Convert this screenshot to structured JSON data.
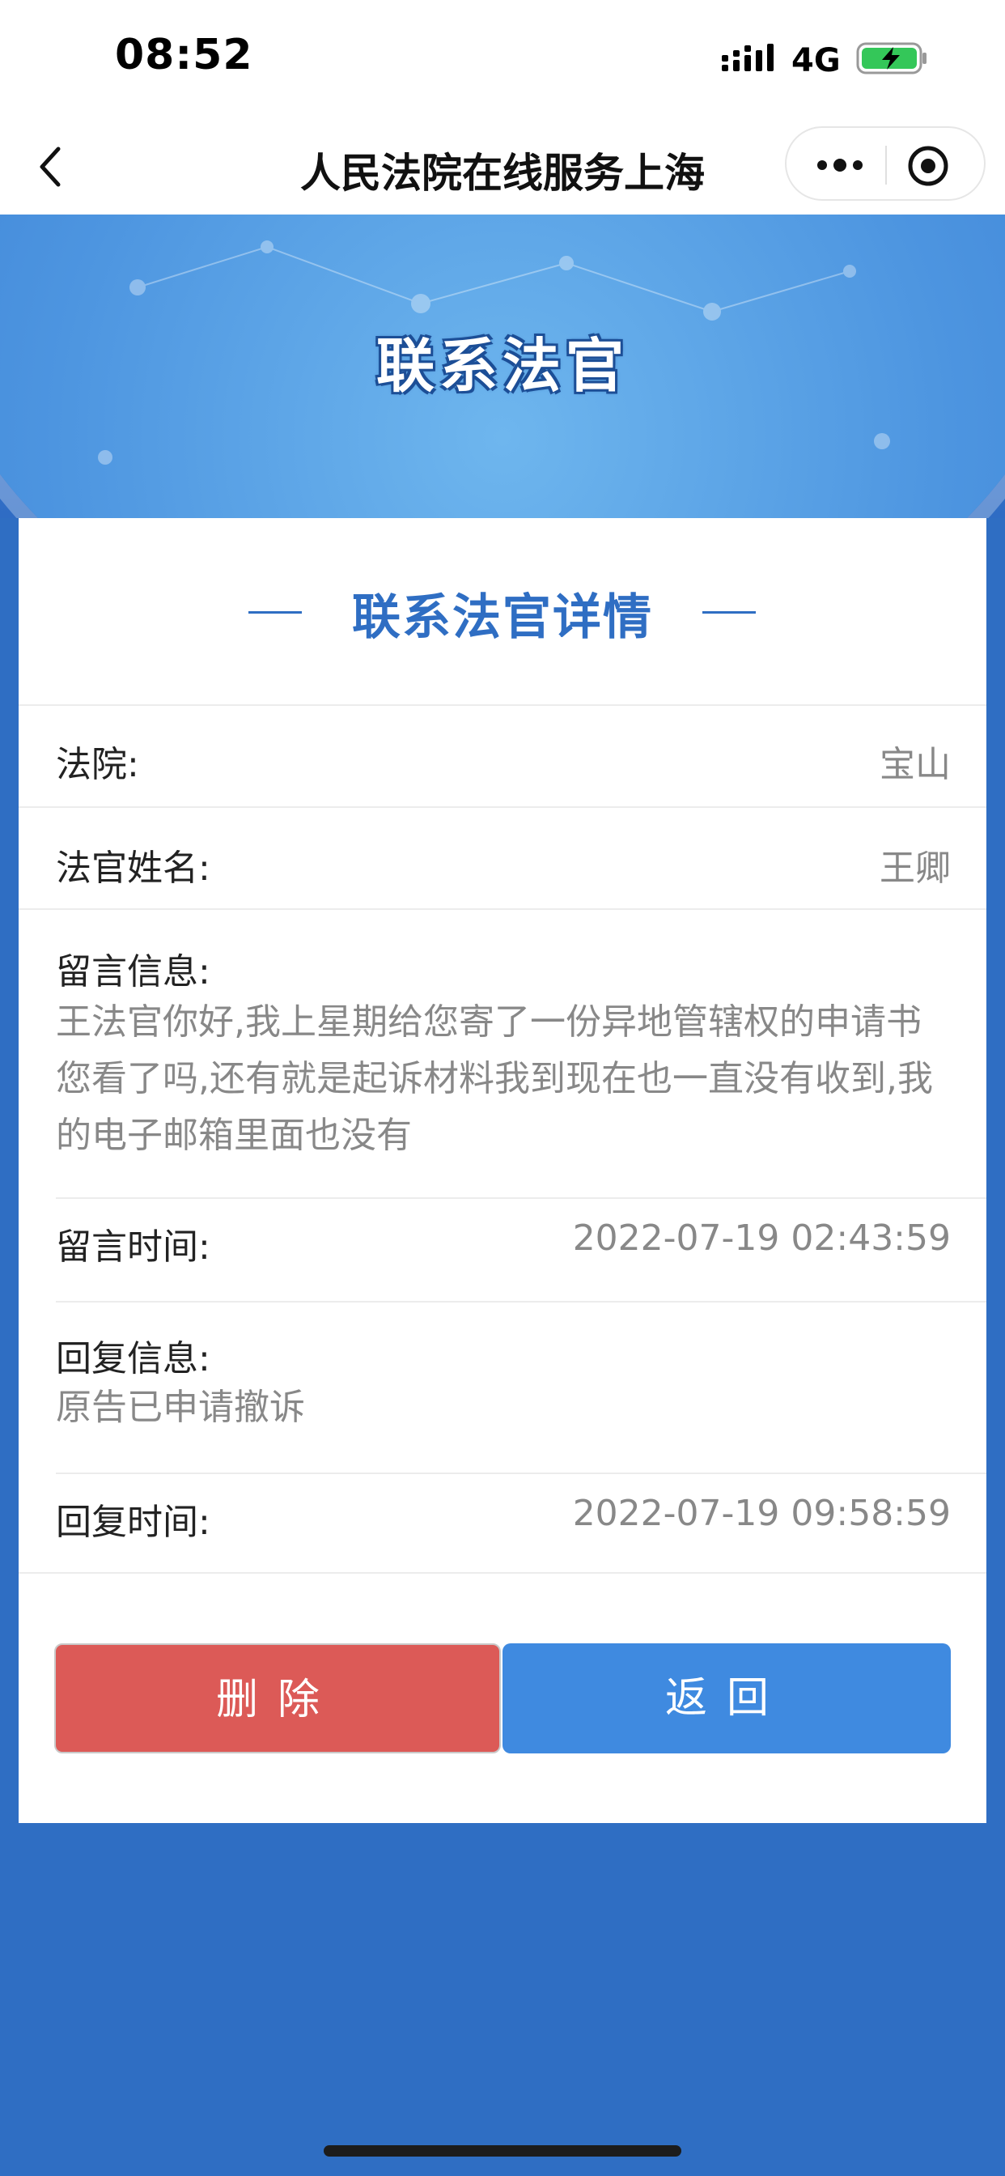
{
  "status_bar": {
    "time": "08:52",
    "network": "4G"
  },
  "nav": {
    "title": "人民法院在线服务上海"
  },
  "banner": {
    "title": "联系法官"
  },
  "detail": {
    "title": "联系法官详情",
    "court_label": "法院:",
    "court_value": "宝山",
    "judge_label": "法官姓名:",
    "judge_value": "王卿",
    "message_label": "留言信息:",
    "message_text": "王法官你好,我上星期给您寄了一份异地管辖权的申请书您看了吗,还有就是起诉材料我到现在也一直没有收到,我的电子邮箱里面也没有",
    "message_time_label": "留言时间:",
    "message_time_value": "2022-07-19 02:43:59",
    "reply_label": "回复信息:",
    "reply_text": "原告已申请撤诉",
    "reply_time_label": "回复时间:",
    "reply_time_value": "2022-07-19 09:58:59"
  },
  "buttons": {
    "delete": "删除",
    "back": "返回"
  },
  "colors": {
    "primary": "#2f6ec3",
    "delete": "#dc5a57",
    "back": "#3f8ae0"
  }
}
